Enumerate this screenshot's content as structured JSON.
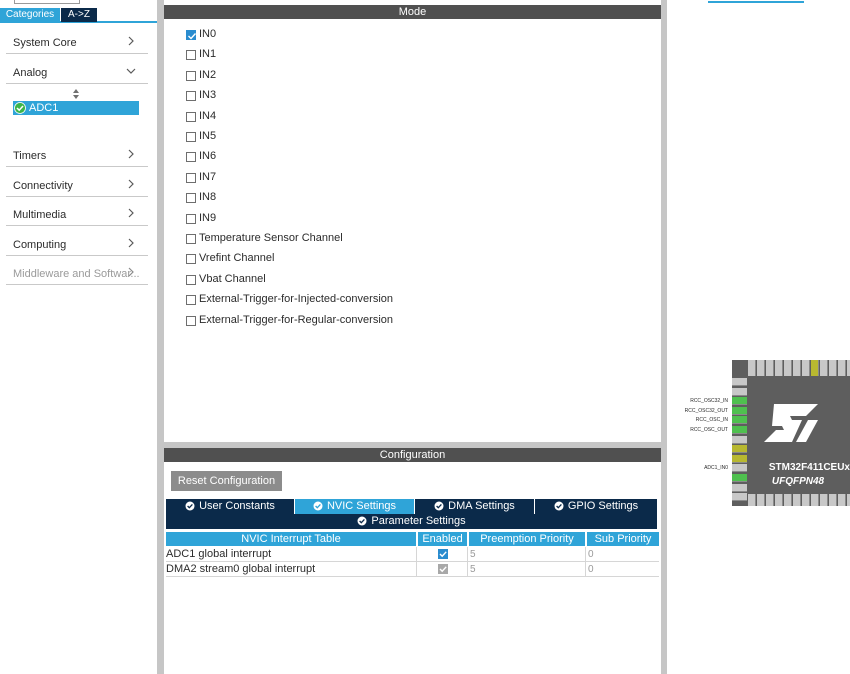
{
  "left": {
    "tabs": [
      "Categories",
      "A->Z"
    ],
    "categories": [
      {
        "label": "System Core",
        "state": "collapsed"
      },
      {
        "label": "Analog",
        "state": "expanded"
      },
      {
        "label": "Timers",
        "state": "collapsed"
      },
      {
        "label": "Connectivity",
        "state": "collapsed"
      },
      {
        "label": "Multimedia",
        "state": "collapsed"
      },
      {
        "label": "Computing",
        "state": "collapsed"
      },
      {
        "label": "Middleware and Softwar...",
        "state": "collapsed"
      }
    ],
    "selected_item": "ADC1"
  },
  "mode": {
    "title": "Mode",
    "channels": [
      {
        "label": "IN0",
        "checked": true
      },
      {
        "label": "IN1",
        "checked": false
      },
      {
        "label": "IN2",
        "checked": false
      },
      {
        "label": "IN3",
        "checked": false
      },
      {
        "label": "IN4",
        "checked": false
      },
      {
        "label": "IN5",
        "checked": false
      },
      {
        "label": "IN6",
        "checked": false
      },
      {
        "label": "IN7",
        "checked": false
      },
      {
        "label": "IN8",
        "checked": false
      },
      {
        "label": "IN9",
        "checked": false
      },
      {
        "label": "Temperature Sensor Channel",
        "checked": false
      },
      {
        "label": "Vrefint Channel",
        "checked": false
      },
      {
        "label": "Vbat Channel",
        "checked": false
      },
      {
        "label": "External-Trigger-for-Injected-conversion",
        "checked": false
      },
      {
        "label": "External-Trigger-for-Regular-conversion",
        "checked": false
      }
    ]
  },
  "config": {
    "title": "Configuration",
    "reset_label": "Reset Configuration",
    "tabs": [
      "User Constants",
      "NVIC Settings",
      "DMA Settings",
      "GPIO Settings",
      "Parameter Settings"
    ],
    "active_tab": "NVIC Settings",
    "table": {
      "headers": [
        "NVIC Interrupt Table",
        "Enabled",
        "Preemption Priority",
        "Sub Priority"
      ],
      "rows": [
        {
          "name": "ADC1 global interrupt",
          "enabled": true,
          "preemption": "5",
          "sub": "0"
        },
        {
          "name": "DMA2 stream0 global interrupt",
          "enabled": true,
          "preemption": "5",
          "sub": "0"
        }
      ]
    }
  },
  "pinout": {
    "chip_name": "STM32F411CEUx",
    "package": "UFQFPN48",
    "pin_labels": [
      "RCC_OSC32_IN",
      "RCC_OSC32_OUT",
      "RCC_OSC_IN",
      "RCC_OSC_OUT",
      "ADC1_IN0"
    ],
    "colors": {
      "assigned_pin": "#4fc04f",
      "power_pin": "#b8b830",
      "chip_body": "#5e5e5e",
      "accent": "#2fa4d8",
      "dark_tab": "#0b2a4a"
    }
  }
}
